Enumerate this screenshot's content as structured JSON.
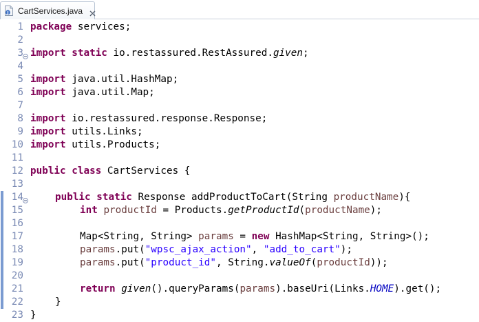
{
  "tab": {
    "label": "CartServices.java",
    "icon": "java-file-icon",
    "close_icon": "close-icon"
  },
  "editor": {
    "lines": [
      {
        "n": "1",
        "indent": 0,
        "tokens": [
          {
            "t": "package",
            "c": "kw"
          },
          {
            "t": " services;",
            "c": ""
          }
        ]
      },
      {
        "n": "2",
        "indent": 0,
        "tokens": []
      },
      {
        "n": "3",
        "indent": 0,
        "fold": true,
        "tokens": [
          {
            "t": "import",
            "c": "kw"
          },
          {
            "t": " ",
            "c": ""
          },
          {
            "t": "static",
            "c": "kw"
          },
          {
            "t": " io.restassured.RestAssured.",
            "c": ""
          },
          {
            "t": "given",
            "c": "it"
          },
          {
            "t": ";",
            "c": ""
          }
        ]
      },
      {
        "n": "4",
        "indent": 0,
        "tokens": []
      },
      {
        "n": "5",
        "indent": 0,
        "tokens": [
          {
            "t": "import",
            "c": "kw"
          },
          {
            "t": " java.util.HashMap;",
            "c": ""
          }
        ]
      },
      {
        "n": "6",
        "indent": 0,
        "tokens": [
          {
            "t": "import",
            "c": "kw"
          },
          {
            "t": " java.util.Map;",
            "c": ""
          }
        ]
      },
      {
        "n": "7",
        "indent": 0,
        "tokens": []
      },
      {
        "n": "8",
        "indent": 0,
        "tokens": [
          {
            "t": "import",
            "c": "kw"
          },
          {
            "t": " io.restassured.response.Response;",
            "c": ""
          }
        ]
      },
      {
        "n": "9",
        "indent": 0,
        "tokens": [
          {
            "t": "import",
            "c": "kw"
          },
          {
            "t": " utils.Links;",
            "c": ""
          }
        ]
      },
      {
        "n": "10",
        "indent": 0,
        "tokens": [
          {
            "t": "import",
            "c": "kw"
          },
          {
            "t": " utils.Products;",
            "c": ""
          }
        ]
      },
      {
        "n": "11",
        "indent": 0,
        "tokens": []
      },
      {
        "n": "12",
        "indent": 0,
        "tokens": [
          {
            "t": "public",
            "c": "kw"
          },
          {
            "t": " ",
            "c": ""
          },
          {
            "t": "class",
            "c": "kw"
          },
          {
            "t": " CartServices {",
            "c": ""
          }
        ]
      },
      {
        "n": "13",
        "indent": 0,
        "tokens": []
      },
      {
        "n": "14",
        "indent": 1,
        "fold": true,
        "changed": true,
        "tokens": [
          {
            "t": "public",
            "c": "kw"
          },
          {
            "t": " ",
            "c": ""
          },
          {
            "t": "static",
            "c": "kw"
          },
          {
            "t": " Response addProductToCart(String ",
            "c": ""
          },
          {
            "t": "productName",
            "c": "var"
          },
          {
            "t": "){",
            "c": ""
          }
        ]
      },
      {
        "n": "15",
        "indent": 2,
        "changed": true,
        "tokens": [
          {
            "t": "int",
            "c": "kw"
          },
          {
            "t": " ",
            "c": ""
          },
          {
            "t": "productId",
            "c": "var"
          },
          {
            "t": " = Products.",
            "c": ""
          },
          {
            "t": "getProductId",
            "c": "it"
          },
          {
            "t": "(",
            "c": ""
          },
          {
            "t": "productName",
            "c": "var"
          },
          {
            "t": ");",
            "c": ""
          }
        ]
      },
      {
        "n": "16",
        "indent": 0,
        "changed": true,
        "tokens": []
      },
      {
        "n": "17",
        "indent": 2,
        "changed": true,
        "tokens": [
          {
            "t": "Map<String, String> ",
            "c": ""
          },
          {
            "t": "params",
            "c": "var"
          },
          {
            "t": " = ",
            "c": ""
          },
          {
            "t": "new",
            "c": "kw"
          },
          {
            "t": " HashMap<String, String>();",
            "c": ""
          }
        ]
      },
      {
        "n": "18",
        "indent": 2,
        "changed": true,
        "tokens": [
          {
            "t": "params",
            "c": "var"
          },
          {
            "t": ".put(",
            "c": ""
          },
          {
            "t": "\"wpsc_ajax_action\"",
            "c": "str"
          },
          {
            "t": ", ",
            "c": ""
          },
          {
            "t": "\"add_to_cart\"",
            "c": "str"
          },
          {
            "t": ");",
            "c": ""
          }
        ]
      },
      {
        "n": "19",
        "indent": 2,
        "changed": true,
        "tokens": [
          {
            "t": "params",
            "c": "var"
          },
          {
            "t": ".put(",
            "c": ""
          },
          {
            "t": "\"product_id\"",
            "c": "str"
          },
          {
            "t": ", String.",
            "c": ""
          },
          {
            "t": "valueOf",
            "c": "it"
          },
          {
            "t": "(",
            "c": ""
          },
          {
            "t": "productId",
            "c": "var"
          },
          {
            "t": "));",
            "c": ""
          }
        ]
      },
      {
        "n": "20",
        "indent": 0,
        "changed": true,
        "tokens": []
      },
      {
        "n": "21",
        "indent": 2,
        "changed": true,
        "tokens": [
          {
            "t": "return",
            "c": "kw"
          },
          {
            "t": " ",
            "c": ""
          },
          {
            "t": "given",
            "c": "it"
          },
          {
            "t": "().queryParams(",
            "c": ""
          },
          {
            "t": "params",
            "c": "var"
          },
          {
            "t": ").baseUri(Links.",
            "c": ""
          },
          {
            "t": "HOME",
            "c": "fld"
          },
          {
            "t": ").get();",
            "c": ""
          }
        ]
      },
      {
        "n": "22",
        "indent": 1,
        "changed": true,
        "tokens": [
          {
            "t": "}",
            "c": ""
          }
        ]
      },
      {
        "n": "23",
        "indent": 0,
        "tokens": [
          {
            "t": "}",
            "c": ""
          }
        ]
      }
    ]
  },
  "colors": {
    "keyword": "#7f0055",
    "string": "#2a00ff",
    "local_variable": "#6a3e3e",
    "static_field": "#0000c0",
    "line_number": "#7a8ab4",
    "change_marker": "#7b9bd1"
  }
}
